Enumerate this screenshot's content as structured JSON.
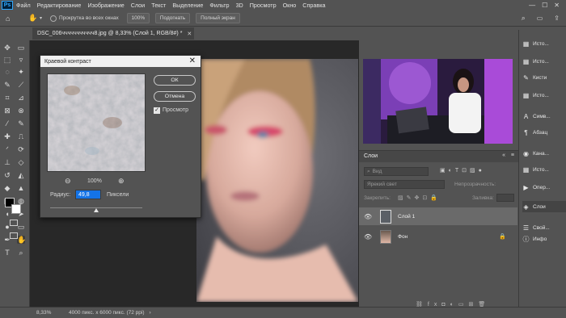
{
  "app": {
    "logo": "Ps"
  },
  "menu": [
    "Файл",
    "Редактирование",
    "Изображение",
    "Слои",
    "Текст",
    "Выделение",
    "Фильтр",
    "3D",
    "Просмотр",
    "Окно",
    "Справка"
  ],
  "options_bar": {
    "scroll_all_label": "Прокрутка во всех окнах",
    "zoom_value": "100%",
    "fit_label": "Подогнать",
    "fullscreen_label": "Полный экран"
  },
  "document": {
    "tab_title": "DSC_006ччччччччччч8.jpg @ 8,33% (Слой 1, RGB/8#) *"
  },
  "dialog": {
    "title": "Краевой контраст",
    "ok_label": "ОК",
    "cancel_label": "Отмена",
    "preview_label": "Просмотр",
    "preview_checked": true,
    "zoom_percent": "100%",
    "radius_label": "Радиус:",
    "radius_value": "49,8",
    "radius_unit": "Пиксели",
    "radius_slider_fraction": 0.5
  },
  "layers_panel": {
    "tab_label": "Слои",
    "search_placeholder": "Вид",
    "blend_mode": "Ярекий свет",
    "opacity_label": "Непрозрачность:",
    "lock_label": "Закрепить:",
    "fill_label": "Заливка:",
    "layers": [
      {
        "name": "Слой 1",
        "selected": true
      },
      {
        "name": "Фон",
        "selected": false,
        "locked": true
      }
    ]
  },
  "panel_strip": [
    {
      "label": "Исто...",
      "icon": "history-icon"
    },
    {
      "label": "Исто...",
      "icon": "history-icon"
    },
    {
      "label": "Кисти",
      "icon": "brush-icon"
    },
    {
      "label": "Исто...",
      "icon": "history-icon"
    },
    {
      "label": "Симв...",
      "icon": "character-icon"
    },
    {
      "label": "Абзац",
      "icon": "paragraph-icon"
    },
    {
      "label": "Кана...",
      "icon": "channels-icon"
    },
    {
      "label": "Исто...",
      "icon": "history-icon"
    },
    {
      "label": "Опер...",
      "icon": "actions-icon"
    },
    {
      "label": "Слои",
      "icon": "layers-icon"
    },
    {
      "label": "Свой...",
      "icon": "properties-icon"
    },
    {
      "label": "Инфо",
      "icon": "info-icon"
    }
  ],
  "status": {
    "zoom": "8,33%",
    "doc_size": "4000 пикс. x 6000 пикс. (72 ppi)"
  },
  "colors": {
    "accent": "#1473e6",
    "dialog_title": "#f0f0f0"
  }
}
